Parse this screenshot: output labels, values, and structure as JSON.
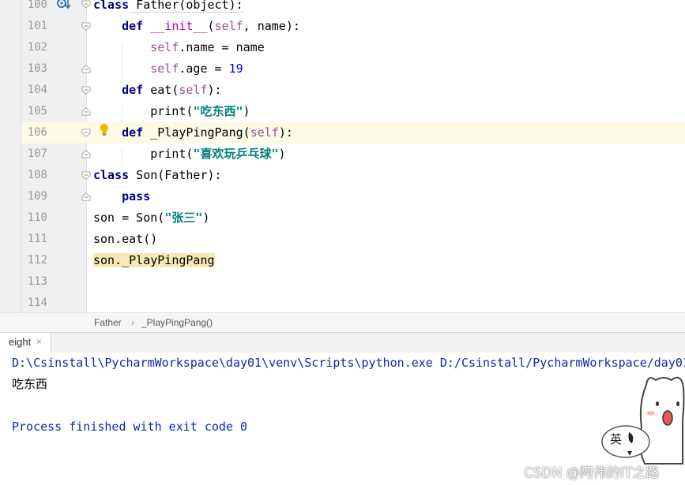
{
  "editor": {
    "lines": [
      {
        "num": "100"
      },
      {
        "num": "101"
      },
      {
        "num": "102"
      },
      {
        "num": "103"
      },
      {
        "num": "104"
      },
      {
        "num": "105"
      },
      {
        "num": "106"
      },
      {
        "num": "107"
      },
      {
        "num": "108"
      },
      {
        "num": "109"
      },
      {
        "num": "110"
      },
      {
        "num": "111"
      },
      {
        "num": "112"
      },
      {
        "num": "113"
      },
      {
        "num": "114"
      }
    ],
    "code": {
      "l100_kw": "class",
      "l100_rest": " Father(object):",
      "l101_kw": "def",
      "l101_fn": "__init__",
      "l101_p1": "(",
      "l101_self": "self",
      "l101_p2": ", name):",
      "l102_self": "self",
      "l102_rest": ".name = name",
      "l103_self": "self",
      "l103_rest": ".age = ",
      "l103_num": "19",
      "l104_kw": "def",
      "l104_rest": " eat(",
      "l104_self": "self",
      "l104_end": "):",
      "l105_fn": "print(",
      "l105_str": "\"吃东西\"",
      "l105_end": ")",
      "l106_kw": "def",
      "l106_rest": " _PlayPingPang(",
      "l106_self": "self",
      "l106_end": "):",
      "l107_fn": "print(",
      "l107_str": "\"喜欢玩乒乓球\"",
      "l107_end": ")",
      "l108_kw": "class",
      "l108_rest": " Son(Father):",
      "l109_kw": "pass",
      "l110_a": "son = Son(",
      "l110_str": "\"张三\"",
      "l110_end": ")",
      "l111": "son.eat()",
      "l112": "son._PlayPingPang"
    }
  },
  "breadcrumb": {
    "items": [
      "Father",
      "_PlayPingPang()"
    ],
    "sep": "›"
  },
  "run": {
    "tab_label": "eight",
    "tab_close": "×",
    "lines": [
      "D:\\Csinstall\\PycharmWorkspace\\day01\\venv\\Scripts\\python.exe D:/Csinstall/PycharmWorkspace/day01",
      "吃东西",
      "Process finished with exit code 0"
    ]
  },
  "sticker": {
    "text": "英"
  },
  "watermark": "CSDN @阿伟的IT之路",
  "icons": [
    "bookmark-run-icon",
    "intention-bulb-icon",
    "fold-marker-icon",
    "separator-chevron-icon",
    "tab-close-icon",
    "input-method-sticker-icon"
  ]
}
